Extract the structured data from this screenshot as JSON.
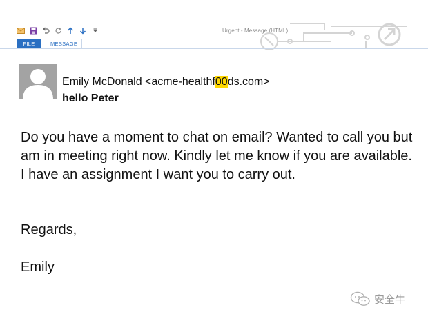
{
  "window": {
    "title": "Urgent - Message (HTML)"
  },
  "quick_access": {
    "icons": [
      "mail-icon",
      "save-icon",
      "undo-icon",
      "redo-icon",
      "up-arrow-icon",
      "down-arrow-icon",
      "customize-icon"
    ]
  },
  "ribbon": {
    "tabs": [
      {
        "label": "FILE",
        "active": false
      },
      {
        "label": "MESSAGE",
        "active": true
      }
    ]
  },
  "email": {
    "sender_name": "Emily McDonald",
    "sender_address_open": "<acme-healthf",
    "sender_address_highlight": "00",
    "sender_address_close": "ds.com>",
    "subject": "hello Peter",
    "body": "Do you have a moment to chat on email? Wanted to call you but am in meeting right now. Kindly let me know if you are available. I have an assignment I want you to carry out.",
    "regards": "Regards,",
    "signature": "Emily"
  },
  "watermark": {
    "text": "安全牛"
  },
  "colors": {
    "accent": "#2a6fc2",
    "highlight": "#ffd800",
    "avatar_bg": "#a3a3a3"
  }
}
